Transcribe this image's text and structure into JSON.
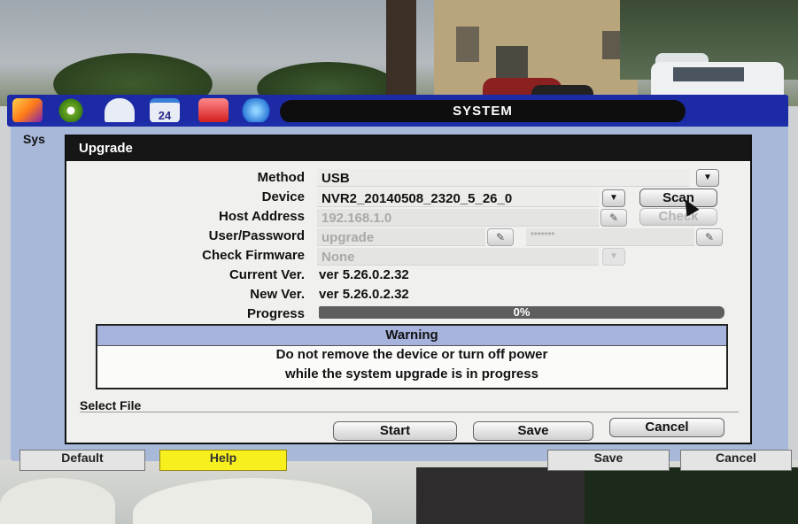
{
  "toolbar": {
    "title": "SYSTEM",
    "icons": [
      "tools-icon",
      "gear-icon",
      "camera-icon",
      "calendar-icon",
      "alarm-icon",
      "network-icon"
    ],
    "calendar_text": "24"
  },
  "background_panel": {
    "tab_label": "Sys",
    "buttons": {
      "default": "Default",
      "help": "Help",
      "save": "Save",
      "cancel": "Cancel"
    }
  },
  "dialog": {
    "title": "Upgrade",
    "method": {
      "label": "Method",
      "value": "USB"
    },
    "device": {
      "label": "Device",
      "value": "NVR2_20140508_2320_5_26_0"
    },
    "host_address": {
      "label": "Host Address",
      "value": "192.168.1.0"
    },
    "user_password": {
      "label": "User/Password",
      "user": "upgrade",
      "password": "*******"
    },
    "check_firmware": {
      "label": "Check Firmware",
      "value": "None"
    },
    "current_ver": {
      "label": "Current Ver.",
      "value": "ver 5.26.0.2.32"
    },
    "new_ver": {
      "label": "New Ver.",
      "value": "ver 5.26.0.2.32"
    },
    "progress": {
      "label": "Progress",
      "text": "0%",
      "fraction": 0.0
    },
    "scan_button": "Scan",
    "check_button": "Check",
    "warning": {
      "title": "Warning",
      "line1": "Do not remove the device or turn off power",
      "line2": "while the system upgrade is in progress"
    },
    "select_file": "Select File",
    "buttons": {
      "start": "Start",
      "save": "Save",
      "cancel": "Cancel"
    }
  },
  "colors": {
    "panel_blue": "#1d2aa6",
    "panel_fill": "#a7b8d8",
    "warning_header": "#a6b3dc",
    "help_yellow": "#f7ef1e"
  }
}
